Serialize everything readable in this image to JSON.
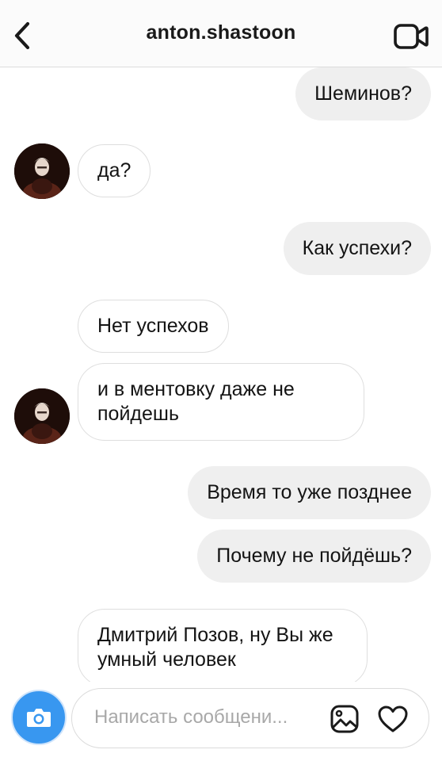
{
  "header": {
    "title": "anton.shastoon",
    "back_icon": "chevron-left-icon",
    "video_icon": "video-camera-icon"
  },
  "messages": [
    {
      "direction": "outgoing",
      "text": "Шеминов?"
    },
    {
      "direction": "incoming",
      "text": "да?",
      "avatar": true
    },
    {
      "direction": "outgoing",
      "text": "Как успехи?"
    },
    {
      "direction": "incoming",
      "text": "Нет успехов"
    },
    {
      "direction": "incoming",
      "text": "и в ментовку даже не пойдешь",
      "avatar": true
    },
    {
      "direction": "outgoing",
      "text": "Время то уже позднее"
    },
    {
      "direction": "outgoing",
      "text": "Почему не пойдёшь?"
    },
    {
      "direction": "incoming",
      "text": "Дмитрий Позов, ну Вы же умный человек"
    }
  ],
  "composer": {
    "placeholder": "Написать сообщени...",
    "camera_icon": "camera-icon",
    "gallery_icon": "gallery-icon",
    "heart_icon": "heart-icon"
  },
  "colors": {
    "accent": "#3897f0",
    "outgoing_bubble": "#efefef",
    "incoming_border": "#dedede"
  }
}
